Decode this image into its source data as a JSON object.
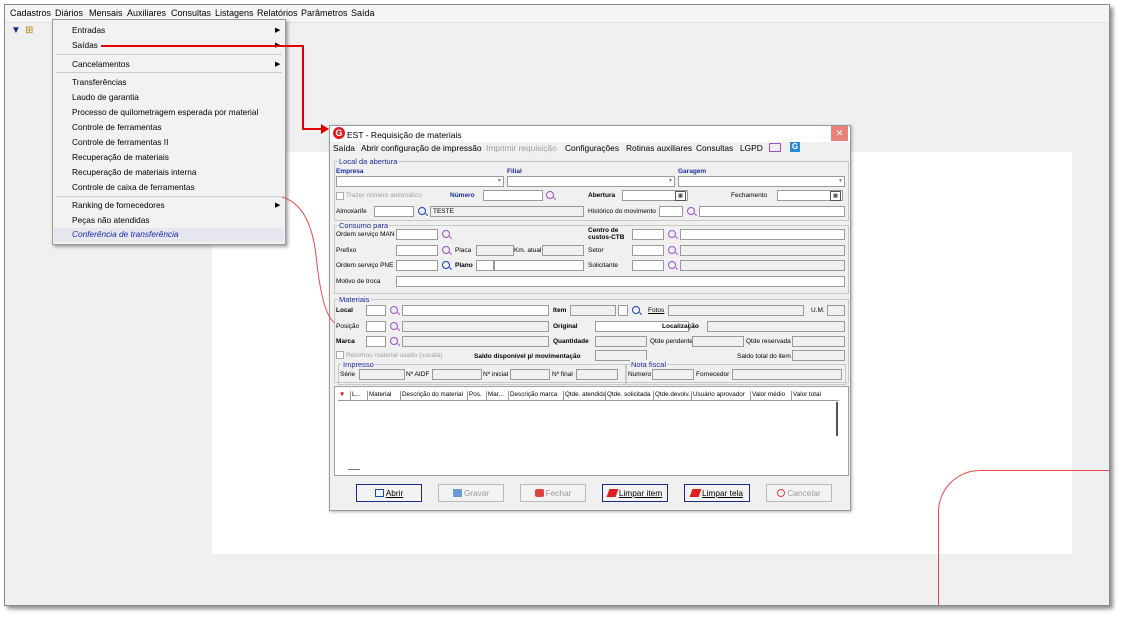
{
  "menubar": [
    "Cadastros",
    "Diários",
    "Mensais",
    "Auxiliares",
    "Consultas",
    "Listagens",
    "Relatórios",
    "Parâmetros",
    "Saída"
  ],
  "dropdown": {
    "items": [
      "Entradas",
      "Saídas",
      "Cancelamentos",
      "Transferências",
      "Laudo de garantia",
      "Processo de quilometragem esperada por material",
      "Controle de ferramentas",
      "Controle de ferramentas II",
      "Recuperação de materiais",
      "Recuperação de materiais interna",
      "Controle de caixa de ferramentas",
      "Ranking de fornecedores",
      "Peças não atendidas",
      "Conferência de transferência"
    ]
  },
  "window": {
    "title": "EST - Requisição de materiais",
    "close": "✕",
    "menu": [
      "Saída",
      "Abrir configuração de impressão",
      "Imprimir requisição",
      "Configurações",
      "Rotinas auxiliares",
      "Consultas",
      "LGPD"
    ],
    "local": {
      "group": "Local da abertura",
      "empresa": "Empresa",
      "filial": "Filial",
      "garagem": "Garagem",
      "trazer": "Trazer número automático",
      "numero": "Número",
      "abertura": "Abertura",
      "fechamento": "Fechamento",
      "almoxarife": "Almoxarife",
      "almox_value": "TESTE",
      "historico": "Histórico do movimento"
    },
    "consumo": {
      "group": "Consumo para",
      "os_man": "Ordem serviço MAN",
      "centro": "Centro de custos-CTB",
      "prefixo": "Prefixo",
      "placa": "Placa",
      "km": "Km. atual",
      "setor": "Setor",
      "os_pne": "Ordem serviço PNE",
      "plano": "Plano",
      "solicitante": "Solicitante",
      "motivo": "Motivo de troca"
    },
    "materiais": {
      "group": "Materiais",
      "local": "Local",
      "item": "Item",
      "fotos": "Fotos",
      "um": "U.M.",
      "posicao": "Posição",
      "original": "Original",
      "localizacao": "Localização",
      "marca": "Marca",
      "quantidade": "Quantidade",
      "qtde_pendente": "Qtde pendente",
      "qtde_reservada": "Qtde reservada",
      "retornou": "Retornou material usado (sucata)",
      "saldo_disp": "Saldo disponível p/ movimentação",
      "saldo_total": "Saldo total do item"
    },
    "impresso": {
      "group": "Impresso",
      "serie": "Série",
      "aidf": "Nº AIDF",
      "inicial": "Nº inicial",
      "final": "Nº final"
    },
    "nota": {
      "group": "Nota fiscal",
      "numero": "Numero",
      "fornecedor": "Fornecedor"
    },
    "grid_columns": [
      "L...",
      "Material",
      "Descrição do material",
      "Pos.",
      "Mar...",
      "Descrição marca",
      "Qtde. atendida",
      "Qtde. solicitada",
      "Qtde.devolv.",
      "Usuário aprovador",
      "Valor médio",
      "Valor total"
    ],
    "buttons": [
      "Abrir",
      "Gravar",
      "Fechar",
      "Limpar item",
      "Limpar tela",
      "Cancelar"
    ]
  }
}
